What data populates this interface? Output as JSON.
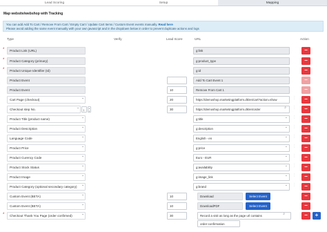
{
  "tabs": [
    "Lead Scoring",
    "Setup",
    "Mapping"
  ],
  "title": "Map website/webshop with Tracking",
  "notice": {
    "line1": "You can add Add To Cart / Remove From Cart / Empty Cart / Update Cart Items / Custom Event events manually.",
    "read_more": "Read here",
    "line2": "Please avoid adding the same event manually with your own javascript and in the dropdown below in order to prevent duplicate actions and logs"
  },
  "columns": {
    "type": "Type",
    "verify": "Verify",
    "lead_score": "Lead Score",
    "url": "URL",
    "action": "Action"
  },
  "rows": {
    "r0": {
      "type": "Product Link (URL)",
      "url": "g:link"
    },
    "r1": {
      "type": "Product Category (primary)",
      "url": "g:product_type"
    },
    "r2": {
      "type": "Product Unique Identifier (Id)",
      "url": "g:id"
    },
    "r3": {
      "type": "Product Event",
      "score": "",
      "url": "Add To Cart Event 1"
    },
    "r4": {
      "type": "Product Event",
      "score": "10",
      "url": "Remove From Cart 1"
    },
    "r5": {
      "type": "Cart Page (checkout)",
      "score": "20",
      "url": "https://demoshop.marketingplatform.dk/en/cart?action=show"
    },
    "r6": {
      "type": "Checkout step No.",
      "step": "1",
      "score": "30",
      "url": "https://demoshop.marketingplatform.dk/en/order"
    },
    "r7": {
      "type": "Product Title (product name)",
      "url": "g:title"
    },
    "r8": {
      "type": "Product Description",
      "url": "g:description"
    },
    "r9": {
      "type": "Language Code",
      "url": "English - en"
    },
    "r10": {
      "type": "Product Price",
      "url": "g:price"
    },
    "r11": {
      "type": "Product Curency Code",
      "url": "Euro - EUR"
    },
    "r12": {
      "type": "Product Stock Status",
      "url": "g:availability"
    },
    "r13": {
      "type": "Product Image",
      "url": "g:image_link"
    },
    "r14": {
      "type": "Product Category (optional secondary category)",
      "url": "g:brand"
    },
    "r15": {
      "type": "Custom Event (BETA)",
      "score": "10",
      "event": "Download",
      "button": "Select Event"
    },
    "r16": {
      "type": "Custom Event (BETA)",
      "score": "10",
      "event": "DownloadPDF",
      "button": "Select Event"
    },
    "r17": {
      "type": "Checkout Thank You Page (order confirmed)",
      "score": "30",
      "url": "Record a visit as long as the page url contains"
    }
  },
  "extra_value": "order-confirmation",
  "icons": {
    "delete": "minus",
    "add": "plus",
    "search": "search-icon",
    "dropdown": "chevron-down-icon",
    "drag": "drag-handle-icon"
  },
  "colors": {
    "delete": "#e8383e",
    "delete_disabled": "#f0a1a3",
    "primary": "#2563c9",
    "notice_bg": "#dcedf8"
  }
}
